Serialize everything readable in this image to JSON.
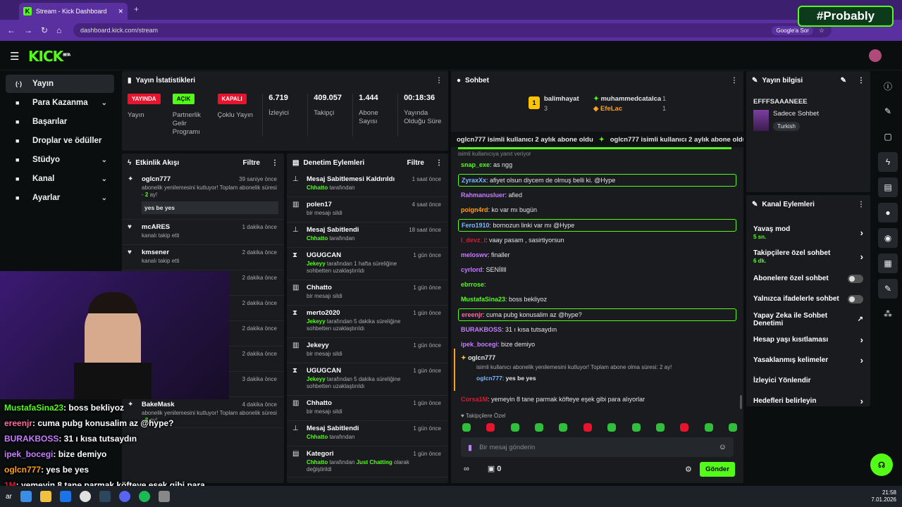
{
  "browser": {
    "tab_title": "Stream - Kick Dashboard",
    "url": "dashboard.kick.com/stream",
    "google_btn": "Google'a Sor"
  },
  "watermark": "#Probably",
  "logo": "KICK",
  "logo_beta": "BETA",
  "sidebar": {
    "items": [
      {
        "label": "Yayın",
        "icon": "broadcast-icon",
        "active": true
      },
      {
        "label": "Para Kazanma",
        "icon": "money-icon",
        "chevron": true
      },
      {
        "label": "Başarılar",
        "icon": "trophy-icon"
      },
      {
        "label": "Droplar ve ödüller",
        "icon": "gift-icon"
      },
      {
        "label": "Stüdyo",
        "icon": "studio-icon",
        "chevron": true
      },
      {
        "label": "Kanal",
        "icon": "channel-icon",
        "chevron": true
      },
      {
        "label": "Ayarlar",
        "icon": "settings-icon",
        "chevron": true
      }
    ]
  },
  "stats": {
    "title": "Yayın İstatistikleri",
    "badges": [
      {
        "badge": "YAYINDA",
        "label": "Yayın",
        "color": "#e8132d"
      },
      {
        "badge": "AÇIK",
        "label": "Partnerlik Gelir Programı",
        "color": "#53fc18"
      },
      {
        "badge": "KAPALI",
        "label": "Çoklu Yayın",
        "color": "#e8132d"
      }
    ],
    "numbers": [
      {
        "value": "6.719",
        "label": "İzleyici"
      },
      {
        "value": "409.057",
        "label": "Takipçi"
      },
      {
        "value": "1.444",
        "label": "Abone Sayısı"
      },
      {
        "value": "00:18:36",
        "label": "Yayında Olduğu Süre"
      }
    ]
  },
  "activity": {
    "title": "Etkinlik Akışı",
    "filter": "Filtre",
    "items": [
      {
        "name": "oglcn777",
        "time": "39 saniye önce",
        "sub": "abonelik yenilemesini kutluyor! Toplam abonelik süresi - ",
        "highlight": "2",
        "sub2": " ay!",
        "msg": "yes be yes"
      },
      {
        "name": "mcARES",
        "time": "1 dakika önce",
        "sub": "kanalı takip etti"
      },
      {
        "name": "kmsener",
        "time": "2 dakika önce",
        "sub": "kanalı takip etti"
      },
      {
        "time": "2 dakika önce"
      },
      {
        "time": "2 dakika önce"
      },
      {
        "time": "2 dakika önce",
        "sub": "Toplam abonelik"
      },
      {
        "time": "2 dakika önce"
      },
      {
        "name": "xEveshka",
        "time": "3 dakika önce",
        "sub": "kanalı takip etti"
      },
      {
        "name": "BakeMask",
        "time": "4 dakika önce",
        "sub": "abonelik yenilemesini kutluyor! Toplam abonelik süresi - ",
        "highlight": "8",
        "sub2": " ay!"
      }
    ]
  },
  "moderation": {
    "title": "Denetim Eylemleri",
    "filter": "Filtre",
    "items": [
      {
        "name": "Mesaj Sabitlemesi Kaldırıldı",
        "time": "1 saat önce",
        "actor": "Chhatto",
        "rest": " tarafından",
        "icon": "pin-icon"
      },
      {
        "name": "polen17",
        "time": "4 saat önce",
        "rest": "bir mesajı sildi",
        "icon": "trash-icon"
      },
      {
        "name": "Mesaj Sabitlendi",
        "time": "18 saat önce",
        "actor": "Chhatto",
        "rest": " tarafından",
        "icon": "pin-icon"
      },
      {
        "name": "UGUGCAN",
        "time": "1 gün önce",
        "actor": "Jekeyy",
        "rest": " tarafından 1 hafta süreliğine sohbetten uzaklaştırıldı",
        "icon": "hourglass-icon"
      },
      {
        "name": "Chhatto",
        "time": "1 gün önce",
        "rest": "bir mesajı sildi",
        "icon": "trash-icon"
      },
      {
        "name": "merto2020",
        "time": "1 gün önce",
        "actor": "Jekeyy",
        "rest": " tarafından 5 dakika süreliğine sohbetten uzaklaştırıldı",
        "icon": "hourglass-icon"
      },
      {
        "name": "Jekeyy",
        "time": "1 gün önce",
        "rest": "bir mesajı sildi",
        "icon": "trash-icon"
      },
      {
        "name": "UGUGCAN",
        "time": "1 gün önce",
        "actor": "Jekeyy",
        "rest": " tarafından 5 dakika süreliğine sohbetten uzaklaştırıldı",
        "icon": "hourglass-icon"
      },
      {
        "name": "Chhatto",
        "time": "1 gün önce",
        "rest": "bir mesajı sildi",
        "icon": "trash-icon"
      },
      {
        "name": "Mesaj Sabitlendi",
        "time": "1 gün önce",
        "actor": "Chhatto",
        "rest": " tarafından",
        "icon": "pin-icon"
      },
      {
        "name": "Kategori",
        "time": "1 gün önce",
        "actor": "Chhatto",
        "rest": " tarafından ",
        "extra": "Just Chatting",
        "rest2": " olarak değiştirildi",
        "icon": "category-icon"
      }
    ]
  },
  "chat": {
    "title": "Sohbet",
    "leaders": [
      {
        "rank": "1",
        "name": "balimhayat",
        "count": "3"
      },
      {
        "name": "muhammedcatalca",
        "count": "1"
      },
      {
        "name": "EfeLac",
        "count": "1"
      }
    ],
    "ticker": "oglcn777 isimli kullanıcı 2 aylık abone oldu",
    "reply_line": "isimli kullanıcıya yanıt veriyor",
    "messages": [
      {
        "user": "snap_exe",
        "text": "as ngg",
        "color": "#53fc18"
      },
      {
        "user": "ZyraxXx",
        "text": "afiyet olsun diycem de olmuş belli ki. @Hype",
        "color": "#7ab8ff",
        "hl": true
      },
      {
        "user": "Rahmanusluer",
        "text": "afied",
        "color": "#c77dff"
      },
      {
        "user": "poign4rd",
        "text": "ko var mı bugün",
        "color": "#ff9f1c"
      },
      {
        "user": "Fero1910",
        "text": "bornozun linki var mı @Hype",
        "color": "#7ab8ff",
        "hl": true
      },
      {
        "user": "l_devz_l",
        "text": "vaay pasam , sasirtiyorsun",
        "color": "#e8132d"
      },
      {
        "user": "meloswv",
        "text": "finaller",
        "color": "#c77dff"
      },
      {
        "user": "cyrlord",
        "text": "SENİllll",
        "color": "#c77dff"
      },
      {
        "user": "ebrrose",
        "text": "",
        "color": "#53fc18"
      },
      {
        "user": "MustafaSina23",
        "text": "boss bekliyoz",
        "color": "#53fc18"
      },
      {
        "user": "ereenjr",
        "text": "cuma pubg konusalim az @hype?",
        "color": "#ff6b9d",
        "hl": true
      },
      {
        "user": "BURAKBOSS",
        "text": "31 ı kısa tutsaydın",
        "color": "#c77dff"
      },
      {
        "user": "ipek_bocegi",
        "text": "bize demiyo",
        "color": "#c77dff"
      }
    ],
    "sub_event": {
      "user": "oglcn777",
      "text": "isimli kullanıcı abonelik yenilemesini kutluyor! Toplam abone olma süresi: 2 ay!",
      "reply_user": "oglcn777",
      "reply_text": "yes be yes"
    },
    "last": {
      "user": "Corsa1M",
      "text": "yemeyin 8 tane parmak köfteye eşek gibi para alıyorlar"
    },
    "followers_only": "Takipçilere Özel",
    "placeholder": "Bir mesaj gönderin",
    "count": "0",
    "send": "Gönder"
  },
  "stream_info": {
    "title": "Yayın bilgisi",
    "stream_title": "EFFFSAAANEEE",
    "category": "Sadece Sohbet",
    "tag": "Turkish"
  },
  "channel_actions": {
    "title": "Kanal Eylemleri",
    "items": [
      {
        "label": "Yavaş mod",
        "sub": "5 sn.",
        "type": "chevron"
      },
      {
        "label": "Takipçilere özel sohbet",
        "sub": "6 dk.",
        "type": "chevron"
      },
      {
        "label": "Abonelere özel sohbet",
        "type": "toggle"
      },
      {
        "label": "Yalnızca ifadelerle sohbet",
        "type": "toggle"
      },
      {
        "label": "Yapay Zeka ile Sohbet Denetimi",
        "type": "external"
      },
      {
        "label": "Hesap yaşı kısıtlaması",
        "type": "chevron"
      },
      {
        "label": "Yasaklanmış kelimeler",
        "type": "chevron"
      },
      {
        "label": "İzleyici Yönlendir",
        "type": "none"
      },
      {
        "label": "Hedefleri belirleyin",
        "type": "chevron"
      }
    ]
  },
  "overlay_chat": [
    {
      "user": "MustafaSina23",
      "text": ": boss bekliyoz",
      "color": "#53fc18"
    },
    {
      "user": "ereenjr",
      "text": ": cuma pubg konusalim az @hype?",
      "color": "#ff6b9d"
    },
    {
      "user": "BURAKBOSS",
      "text": ": 31 ı kısa tutsaydın",
      "color": "#c77dff"
    },
    {
      "user": "ipek_bocegi",
      "text": ": bize demiyo",
      "color": "#c77dff"
    },
    {
      "user": "oglcn777",
      "text": ": yes be yes",
      "color": "#ff9f1c"
    },
    {
      "user": "1M",
      "text": ": yemeyin 8 tane parmak köfteye eşek gibi para",
      "color": "#e8132d"
    }
  ],
  "taskbar": {
    "time": "21:58",
    "date": "7.01.2026",
    "left_text": "ar"
  }
}
